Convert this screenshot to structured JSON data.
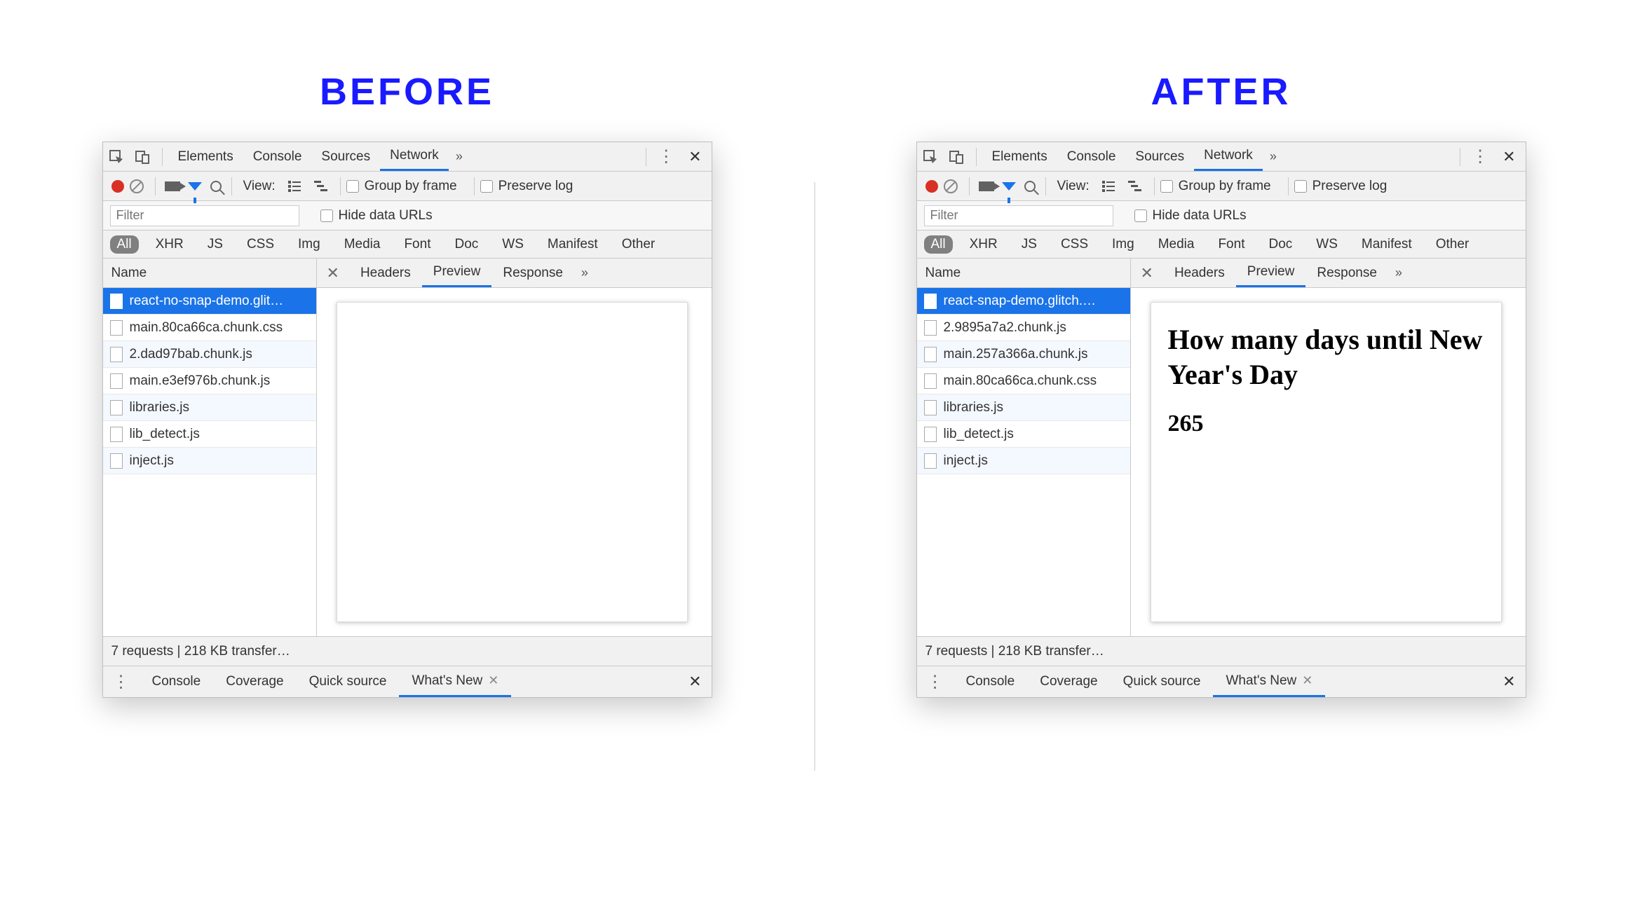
{
  "headings": {
    "before": "BEFORE",
    "after": "AFTER"
  },
  "mainTabs": {
    "elements": "Elements",
    "console": "Console",
    "sources": "Sources",
    "network": "Network"
  },
  "toolbar": {
    "viewLabel": "View:",
    "groupByFrame": "Group by frame",
    "preserveLog": "Preserve log"
  },
  "filterRow": {
    "placeholder": "Filter",
    "hideDataUrls": "Hide data URLs"
  },
  "typePills": [
    "All",
    "XHR",
    "JS",
    "CSS",
    "Img",
    "Media",
    "Font",
    "Doc",
    "WS",
    "Manifest",
    "Other"
  ],
  "columns": {
    "name": "Name"
  },
  "detailTabs": {
    "headers": "Headers",
    "preview": "Preview",
    "response": "Response"
  },
  "status": "7 requests | 218 KB transfer…",
  "drawerTabs": {
    "console": "Console",
    "coverage": "Coverage",
    "quickSource": "Quick source",
    "whatsNew": "What's New"
  },
  "before": {
    "files": [
      "react-no-snap-demo.glit…",
      "main.80ca66ca.chunk.css",
      "2.dad97bab.chunk.js",
      "main.e3ef976b.chunk.js",
      "libraries.js",
      "lib_detect.js",
      "inject.js"
    ],
    "preview": {
      "title": "",
      "count": ""
    }
  },
  "after": {
    "files": [
      "react-snap-demo.glitch.…",
      "2.9895a7a2.chunk.js",
      "main.257a366a.chunk.js",
      "main.80ca66ca.chunk.css",
      "libraries.js",
      "lib_detect.js",
      "inject.js"
    ],
    "preview": {
      "title": "How many days until New Year's Day",
      "count": "265"
    }
  }
}
